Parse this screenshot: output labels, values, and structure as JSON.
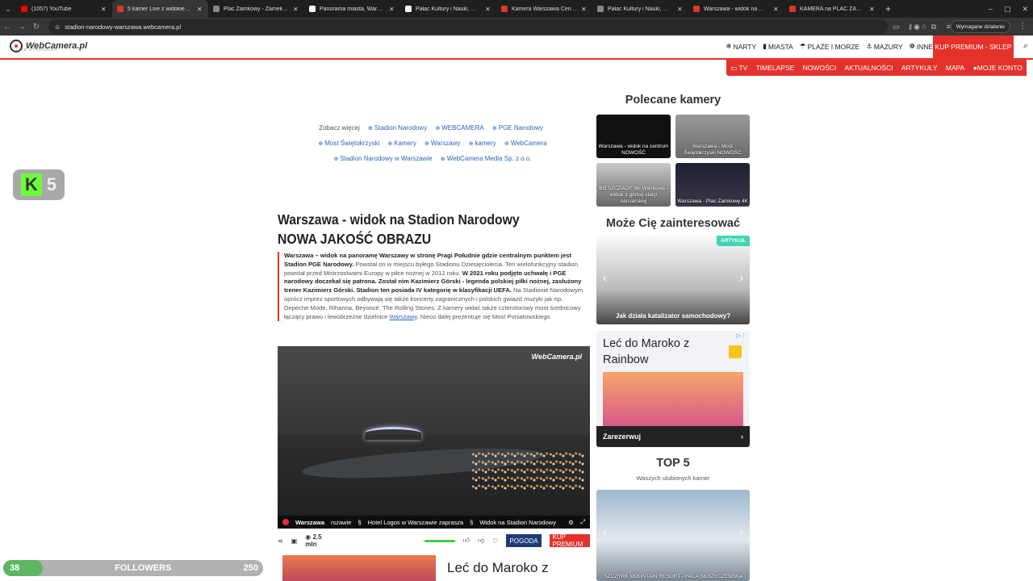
{
  "browser": {
    "tabs": [
      {
        "label": "(1057) YouTube",
        "favicon_color": "#ff0000"
      },
      {
        "label": "5 kamer Live z widokiem na Wa",
        "favicon_color": "#e4322b",
        "active": true
      },
      {
        "label": "Plac Zamkowy - Zamek Królew",
        "favicon_color": "#888888"
      },
      {
        "label": "Panorama miasta, Warszawa -",
        "favicon_color": "#ffffff"
      },
      {
        "label": "Pałac Kultury i Nauki, Warszaw",
        "favicon_color": "#ffffff"
      },
      {
        "label": "Kamera Warszawa Centrum Pał",
        "favicon_color": "#e4322b"
      },
      {
        "label": "Pałac Kultury i Nauki, Warszaw",
        "favicon_color": "#888888"
      },
      {
        "label": "Warszawa - widok na Most Św",
        "favicon_color": "#e4322b"
      },
      {
        "label": "KAMERA na PLAC ZAMKOWY -",
        "favicon_color": "#e4322b"
      }
    ],
    "url": "stadion-narodowy-warszawa.webcamera.pl",
    "action_required": "Wymagane działanie"
  },
  "site": {
    "logo": "WebCamera.pl",
    "logo_sub": "LIVE STREAMING",
    "topnav": [
      "NARTY",
      "MIASTA",
      "PLAŻE I MORZE",
      "MAZURY",
      "INNE"
    ],
    "premium": "KUP PREMIUM - SKLEP",
    "subnav": [
      "TV",
      "TIMELAPSE",
      "NOWOŚCI",
      "AKTUALNOŚCI",
      "ARTYKUŁY",
      "MAPA",
      "MOJE KONTO"
    ]
  },
  "kick": {
    "count": "5"
  },
  "seemore": {
    "label": "Zobacz więcej",
    "tags": [
      "Stadion Narodowy",
      "WEBCAMERA",
      "PGE Narodowy",
      "Most Świętokrzyski",
      "Kamery",
      "Warszawy",
      "kamery",
      "WebCamera",
      "Stadion Narodowy w Warszawie",
      "WebCamera Media Sp. z o.o."
    ]
  },
  "article": {
    "title": "Warszawa - widok na Stadion Narodowy NOWA JAKOŚĆ OBRAZU",
    "desc_bold1": "Warszawa – widok na panoramę Warszawy w stronę Pragi Południe gdzie centralnym punktem jest Stadion PGE Narodowy.",
    "desc_plain1": " Powstał on w miejscu byłego Stadionu Dziesięciolecia. Ten wielofunkcyjny stadion powstał przed Mistrzostwami Europy w piłce nożnej w 2012 roku. ",
    "desc_bold2": "W 2021 roku podjęto uchwałę i PGE narodowy doczekał się patrona. Został nim Kazimierz Górski - legenda polskiej piłki nożnej, zasłużony trener Kazimierz Górski. Stadion ten posiada IV kategorię w klasyfikacji UEFA.",
    "desc_plain2": " Na Stadionie Narodowym oprócz imprez sportowych odbywają się także koncerty zagranicznych i polskich gwiazd muzyki jak np. Depeche Mode, Rihanna, Beyoncé, The Rolling Stones. Z kamery widać także czterotorowy most średnicowy łączący prawo i lewobrzeżne dzielnice ",
    "desc_link": "Warszawy",
    "desc_plain3": ". Nieco dalej prezentuje się Most Poniatowskiego"
  },
  "player": {
    "watermark": "WebCamera.pl",
    "bar_items": [
      "Warszawa",
      "rszawie",
      "Hotel Logos w Warszawie zaprasza",
      "Widok na Stadion Narodowy"
    ]
  },
  "toolbar": {
    "views": "2.5 mln",
    "pogoda": "POGODA",
    "premium": "KUP PREMIUM"
  },
  "ad_bottom": {
    "title": "Leć do Maroko z"
  },
  "sidebar": {
    "featured_title": "Polecane kamery",
    "thumbs": [
      "Warszawa - widok na centrum NOWOŚĆ",
      "Warszawa - Most Świętokrzyski NOWOŚĆ",
      "BIESZCZADY Ski Wańkowa - widok z górnej stacji narciarskiej",
      "Warszawa - Plac Zamkowy 4K"
    ],
    "interest_title": "Może Cię zainteresować",
    "article_badge": "ARTYKUŁ",
    "article_caption": "Jak działa katalizator samochodowy?",
    "ad_title": "Leć do Maroko z Rainbow",
    "ad_cta": "Zarezerwuj",
    "top5_title": "TOP 5",
    "top5_sub": "Waszych ulubionych kamer",
    "top5_caption": "SZCZYRK MOUNTAIN RESORT - HALA SKRZYCZEŃSKA"
  },
  "followers": {
    "current": "38",
    "label": "FOLLOWERS",
    "goal": "250",
    "progress": 0.152
  }
}
